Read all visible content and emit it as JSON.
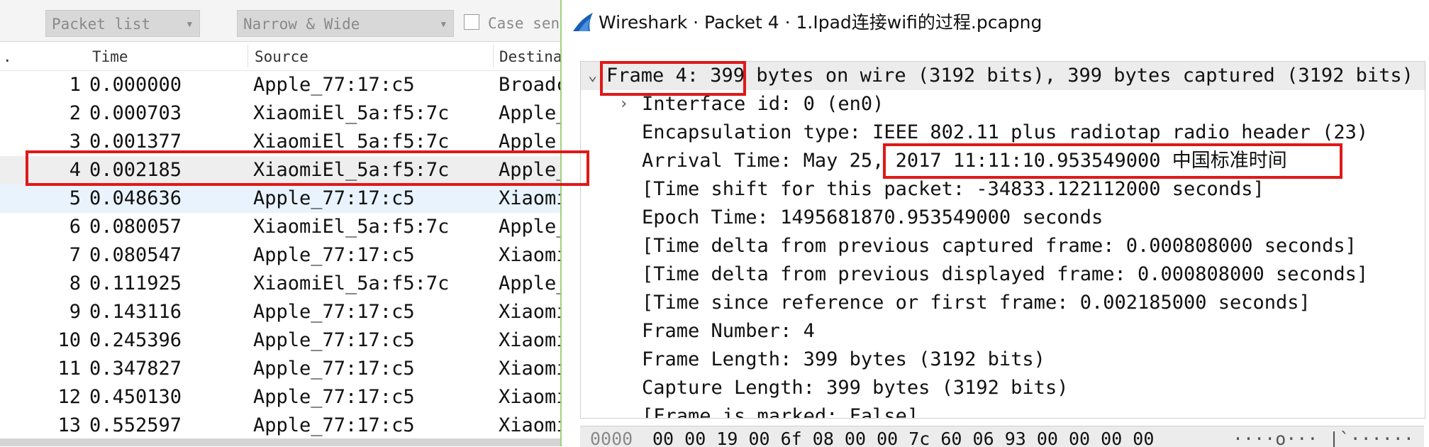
{
  "filter_bar": {
    "search_in": "Packet list",
    "char_width": "Narrow & Wide",
    "case_label": "Case sens"
  },
  "columns": {
    "no": ".",
    "time": "Time",
    "source": "Source",
    "destination": "Destina"
  },
  "packets": [
    {
      "no": "1",
      "time": "0.000000",
      "source": "Apple_77:17:c5",
      "destination": "Broadc"
    },
    {
      "no": "2",
      "time": "0.000703",
      "source": "XiaomiEl_5a:f5:7c",
      "destination": "Apple_"
    },
    {
      "no": "3",
      "time": "0.001377",
      "source": "XiaomiEl_5a:f5:7c",
      "destination": "Apple_"
    },
    {
      "no": "4",
      "time": "0.002185",
      "source": "XiaomiEl_5a:f5:7c",
      "destination": "Apple_"
    },
    {
      "no": "5",
      "time": "0.048636",
      "source": "Apple_77:17:c5",
      "destination": "Xiaomi"
    },
    {
      "no": "6",
      "time": "0.080057",
      "source": "XiaomiEl_5a:f5:7c",
      "destination": "Apple_"
    },
    {
      "no": "7",
      "time": "0.080547",
      "source": "Apple_77:17:c5",
      "destination": "Xiaomi"
    },
    {
      "no": "8",
      "time": "0.111925",
      "source": "XiaomiEl_5a:f5:7c",
      "destination": "Apple_"
    },
    {
      "no": "9",
      "time": "0.143116",
      "source": "Apple_77:17:c5",
      "destination": "Xiaomi"
    },
    {
      "no": "10",
      "time": "0.245396",
      "source": "Apple_77:17:c5",
      "destination": "Xiaomi"
    },
    {
      "no": "11",
      "time": "0.347827",
      "source": "Apple_77:17:c5",
      "destination": "Xiaomi"
    },
    {
      "no": "12",
      "time": "0.450130",
      "source": "Apple_77:17:c5",
      "destination": "Xiaomi"
    },
    {
      "no": "13",
      "time": "0.552597",
      "source": "Apple_77:17:c5",
      "destination": "Xiaomi"
    }
  ],
  "selected_packet": "4",
  "window": {
    "title": "Wireshark · Packet 4 · 1.Ipad连接wifi的过程.pcapng"
  },
  "details": {
    "frame": "Frame 4: 399 bytes on wire (3192 bits), 399 bytes captured (3192 bits)",
    "interface": "Interface id: 0 (en0)",
    "encapsulation": "Encapsulation type: IEEE 802.11 plus radiotap radio header (23)",
    "arrival": "Arrival Time: May 25, 2017 11:11:10.953549000 中国标准时间",
    "time_shift": "[Time shift for this packet: -34833.122112000 seconds]",
    "epoch": "Epoch Time: 1495681870.953549000 seconds",
    "delta_captured": "[Time delta from previous captured frame: 0.000808000 seconds]",
    "delta_displayed": "[Time delta from previous displayed frame: 0.000808000 seconds]",
    "since_reference": "[Time since reference or first frame: 0.002185000 seconds]",
    "frame_number": "Frame Number: 4",
    "frame_length": "Frame Length: 399 bytes (3192 bits)",
    "capture_length": "Capture Length: 399 bytes (3192 bits)",
    "marked": "[Frame is marked: False]"
  },
  "hex": {
    "offset": "0000",
    "bytes": "00 00 19 00 6f 08 00 00  7c 60 06 93 00 00 00 00",
    "ascii": "····o··· |`······"
  },
  "colors": {
    "annotation": "#e01818",
    "selected_row": "#eeeeee",
    "alt_row": "#e9f3fd",
    "window_border": "#9fd17f"
  },
  "icons": {
    "logo": "wireshark-fin-icon",
    "expand": "chevron-down-icon",
    "collapse": "chevron-right-icon"
  }
}
